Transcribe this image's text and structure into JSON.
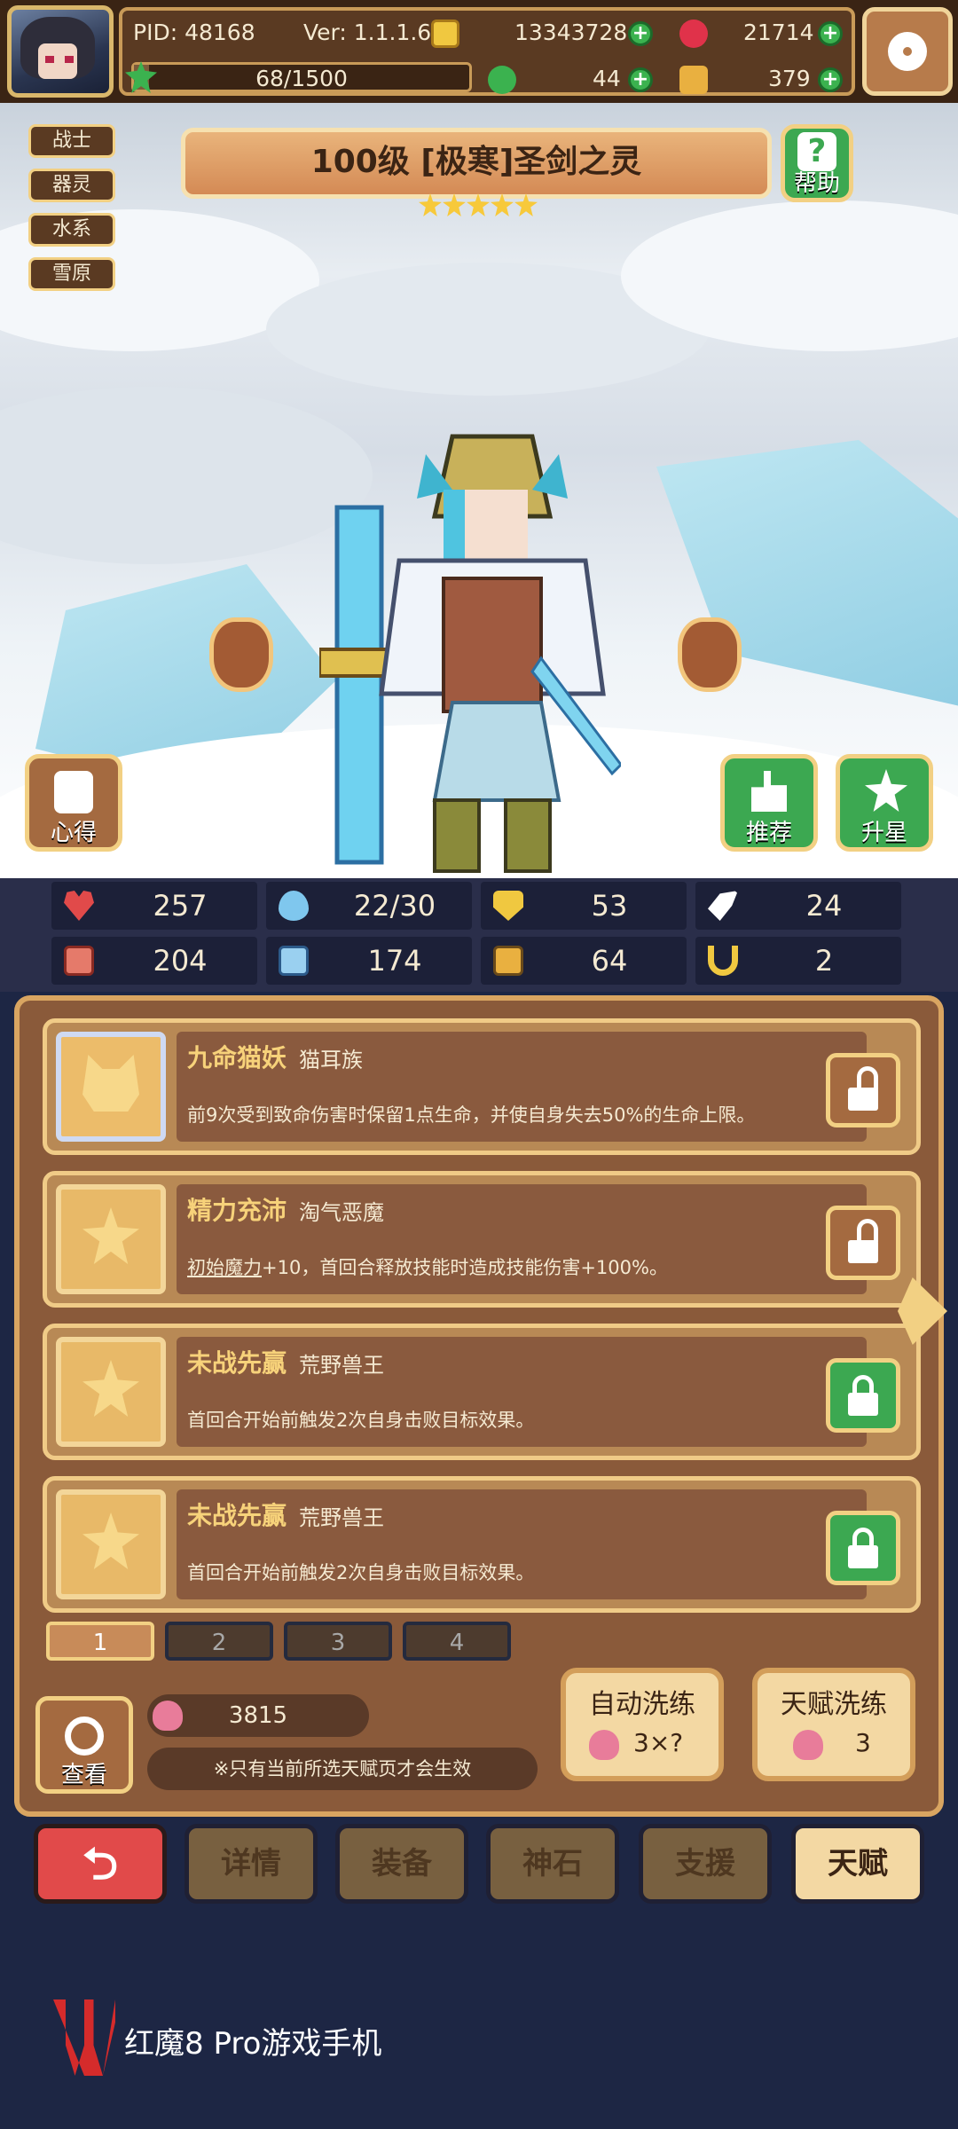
{
  "topbar": {
    "pid": "PID: 48168",
    "version": "Ver: 1.1.1.6",
    "gold": "13343728",
    "gems": "21714",
    "energy": "68/1500",
    "energy_ratio": 0.045,
    "clover": "44",
    "keys": "379"
  },
  "hero": {
    "title": "100级  [极寒]圣剑之灵",
    "stars": 5,
    "tags": [
      "战士",
      "器灵",
      "水系",
      "雪原"
    ],
    "help_label": "帮助",
    "notes_label": "心得",
    "recommend_label": "推荐",
    "upgrade_label": "升星"
  },
  "stats": {
    "hp": "257",
    "mana": "22/30",
    "defense": "53",
    "speed": "24",
    "attack": "204",
    "magic": "174",
    "armor": "64",
    "luck": "2"
  },
  "talents": [
    {
      "name": "九命猫妖",
      "race": "猫耳族",
      "desc": "前9次受到致命伤害时保留1点生命，并使自身失去50%的生命上限。",
      "locked": false
    },
    {
      "name": "精力充沛",
      "race": "淘气恶魔",
      "desc_link": "初始魔力",
      "desc": "+10，首回合释放技能时造成技能伤害+100%。",
      "locked": false
    },
    {
      "name": "未战先赢",
      "race": "荒野兽王",
      "desc": "首回合开始前触发2次自身击败目标效果。",
      "locked": true
    },
    {
      "name": "未战先赢",
      "race": "荒野兽王",
      "desc": "首回合开始前触发2次自身击败目标效果。",
      "locked": true
    }
  ],
  "pages": [
    "1",
    "2",
    "3",
    "4"
  ],
  "view_label": "查看",
  "peach_count": "3815",
  "notice": "※只有当前所选天赋页才会生效",
  "auto_wash": {
    "label": "自动洗练",
    "cost": "3×?"
  },
  "talent_wash": {
    "label": "天赋洗练",
    "cost": "3"
  },
  "nav": [
    "详情",
    "装备",
    "神石",
    "支援",
    "天赋"
  ],
  "brand": "红魔8 Pro游戏手机",
  "colors": {
    "accent_green": "#3ca851",
    "panel_brown": "#8a5a3a",
    "border_gold": "#f2d083",
    "back_red": "#e14a4a"
  }
}
